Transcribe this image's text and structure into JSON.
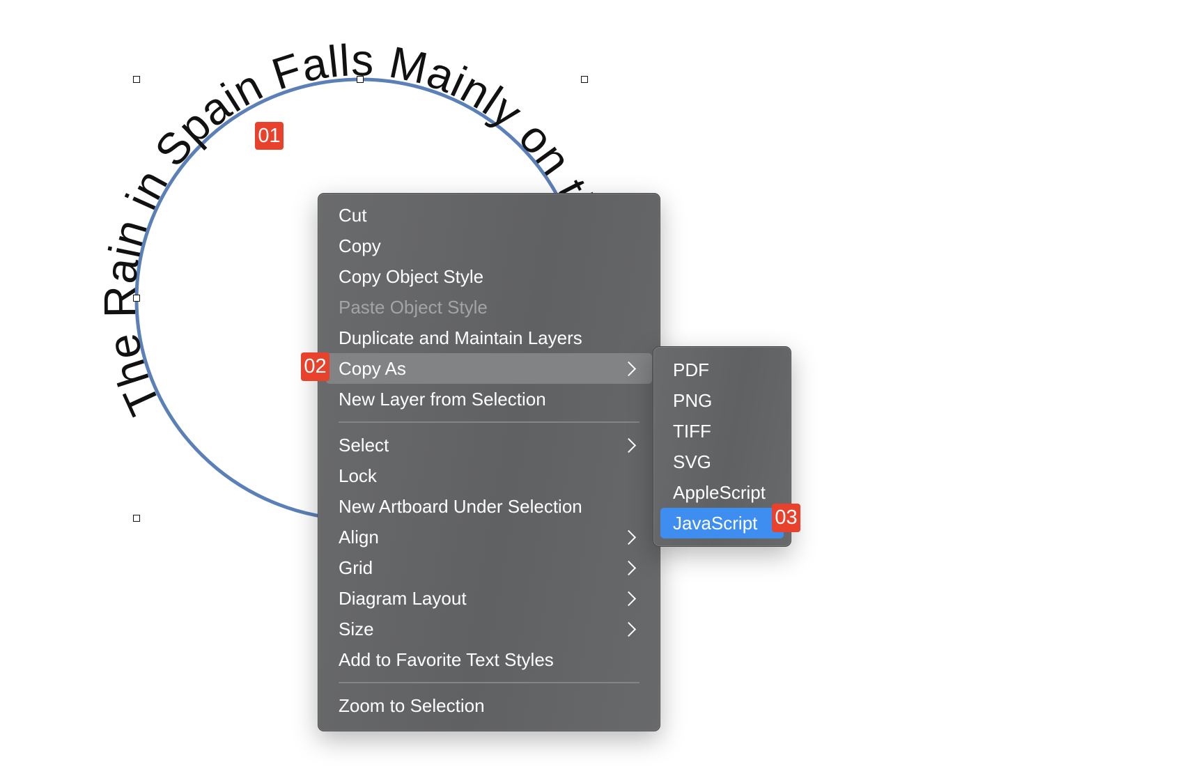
{
  "canvas": {
    "curved_text": "The Rain in Spain Falls Mainly on the Plain",
    "circle_stroke_color": "#5b80b8"
  },
  "badges": {
    "b1": "01",
    "b2": "02",
    "b3": "03"
  },
  "context_menu": {
    "items": [
      {
        "label": "Cut"
      },
      {
        "label": "Copy"
      },
      {
        "label": "Copy Object Style"
      },
      {
        "label": "Paste Object Style",
        "disabled": true
      },
      {
        "label": "Duplicate and Maintain Layers"
      },
      {
        "label": "Copy As",
        "submenu": true,
        "highlighted": true
      },
      {
        "label": "New Layer from Selection"
      },
      {
        "label": "Select",
        "submenu": true
      },
      {
        "label": "Lock"
      },
      {
        "label": "New Artboard Under Selection"
      },
      {
        "label": "Align",
        "submenu": true
      },
      {
        "label": "Grid",
        "submenu": true
      },
      {
        "label": "Diagram Layout",
        "submenu": true
      },
      {
        "label": "Size",
        "submenu": true
      },
      {
        "label": "Add to Favorite Text Styles"
      },
      {
        "label": "Zoom to Selection"
      }
    ]
  },
  "copy_as_submenu": {
    "items": [
      {
        "label": "PDF"
      },
      {
        "label": "PNG"
      },
      {
        "label": "TIFF"
      },
      {
        "label": "SVG"
      },
      {
        "label": "AppleScript"
      },
      {
        "label": "JavaScript",
        "selected": true
      }
    ],
    "selected_color": "#3d8ef0"
  }
}
